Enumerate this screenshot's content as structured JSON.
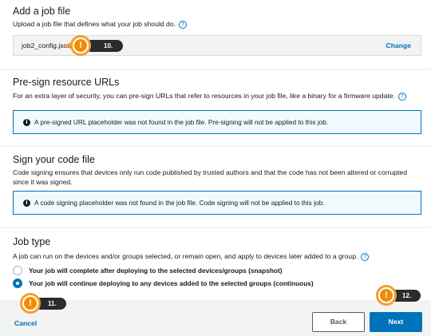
{
  "add_job_file": {
    "heading": "Add a job file",
    "description": "Upload a job file that defines what your job should do.",
    "file_name": "job2_config.json",
    "change_label": "Change"
  },
  "presign": {
    "heading": "Pre-sign resource URLs",
    "description": "For an extra layer of security, you can pre-sign URLs that refer to resources in your job file, like a binary for a firmware update.",
    "alert": "A pre-signed URL placeholder was not found in the job file. Pre-signing will not be applied to this job."
  },
  "sign_code": {
    "heading": "Sign your code file",
    "description": "Code signing ensures that devices only run code published by trusted authors and that the code has not been altered or corrupted since it was signed.",
    "alert": "A code signing placeholder was not found in the job file. Code signing will not be applied to this job."
  },
  "job_type": {
    "heading": "Job type",
    "description": "A job can run on the devices and/or groups selected, or remain open, and apply to devices later added to a group.",
    "options": [
      {
        "label": "Your job will complete after deploying to the selected devices/groups (snapshot)",
        "selected": false
      },
      {
        "label": "Your job will continue deploying to any devices added to the selected groups (continuous)",
        "selected": true
      }
    ]
  },
  "footer": {
    "cancel_label": "Cancel",
    "back_label": "Back",
    "next_label": "Next"
  },
  "callouts": {
    "c10": "10.",
    "c11": "11.",
    "c12": "12.",
    "mark": "!"
  },
  "icons": {
    "info": "info-circle-icon",
    "alert_info": "info-filled-icon"
  },
  "colors": {
    "accent": "#0073bb",
    "callout": "#f08c00",
    "callout_tag": "#2b2b2b",
    "page_bg": "#f2f3f3"
  }
}
